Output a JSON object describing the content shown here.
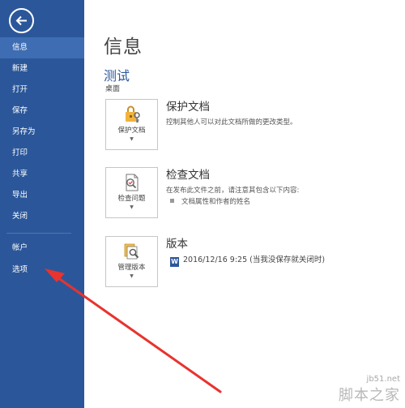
{
  "sidebar": {
    "items": [
      {
        "label": "信息",
        "active": true
      },
      {
        "label": "新建"
      },
      {
        "label": "打开"
      },
      {
        "label": "保存"
      },
      {
        "label": "另存为"
      },
      {
        "label": "打印"
      },
      {
        "label": "共享"
      },
      {
        "label": "导出"
      },
      {
        "label": "关闭"
      },
      {
        "label": "帐户"
      },
      {
        "label": "选项"
      }
    ],
    "back_icon": "back-arrow-circle-icon"
  },
  "main": {
    "title": "信息",
    "doc_name": "测试",
    "doc_path": "桌面",
    "sections": [
      {
        "button_label": "保护文档",
        "title": "保护文档",
        "description": "控制其他人可以对此文档所做的更改类型。",
        "icon": "lock-key-icon"
      },
      {
        "button_label": "检查问题",
        "title": "检查文档",
        "description": "在发布此文件之前，请注意其包含以下内容:",
        "bullet": "文档属性和作者的姓名",
        "icon": "inspect-document-icon"
      },
      {
        "button_label": "管理版本",
        "title": "版本",
        "version_entry": "2016/12/16 9:25 (当我没保存就关闭时)",
        "icon": "manage-versions-icon"
      }
    ]
  },
  "colors": {
    "sidebar_bg": "#2b579a",
    "sidebar_active": "#3e6db3",
    "accent": "#2b579a",
    "annotation_arrow": "#e8332e"
  },
  "watermark": {
    "url": "jb51.net",
    "brand": "脚本之家"
  }
}
